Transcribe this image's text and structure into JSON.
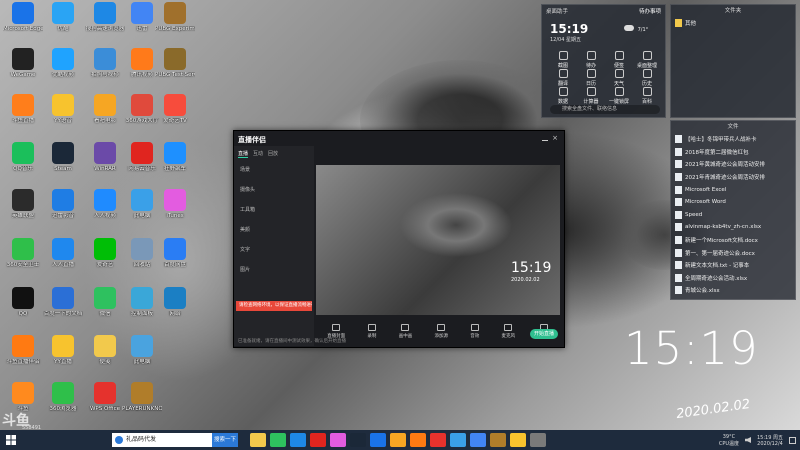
{
  "desktop_icons": [
    {
      "label": "Microsoft Edge",
      "icon": "edge-icon",
      "color": "#1a73e8"
    },
    {
      "label": "优酷",
      "icon": "youku-icon",
      "color": "#2aa4f4"
    },
    {
      "label": "搜狗高速浏览器",
      "icon": "sogou-browser-icon",
      "color": "#1e88e5"
    },
    {
      "label": "迅雷",
      "icon": "thunder-icon",
      "color": "#4285f4"
    },
    {
      "label": "PUBG Experimental",
      "icon": "pubg-icon",
      "color": "#a0702c"
    },
    {
      "label": "WeGame",
      "icon": "wegame-icon",
      "color": "#222222"
    },
    {
      "label": "优酷视频",
      "icon": "youku-video-icon",
      "color": "#1fa3ff"
    },
    {
      "label": "拍照与视频",
      "icon": "photo-icon",
      "color": "#3b8dd8"
    },
    {
      "label": "腾讯视频",
      "icon": "tencent-video-icon",
      "color": "#ff7a1a"
    },
    {
      "label": "PUBG Test Server",
      "icon": "pubg-test-icon",
      "color": "#8a6a2a"
    },
    {
      "label": "斗鱼直播",
      "icon": "douyu-icon",
      "color": "#ff7e1b"
    },
    {
      "label": "YY语音",
      "icon": "yy-icon",
      "color": "#f7c32e"
    },
    {
      "label": "看吧电影",
      "icon": "movie-icon",
      "color": "#f6a623"
    },
    {
      "label": "360游戏大厅",
      "icon": "game-hall-icon",
      "color": "#e04a3c"
    },
    {
      "label": "爱奇艺TV",
      "icon": "iqiyi-tv-icon",
      "color": "#f74c3c"
    },
    {
      "label": "QQ音乐",
      "icon": "qq-music-icon",
      "color": "#1bbf5b"
    },
    {
      "label": "Steam",
      "icon": "steam-icon",
      "color": "#1b2838"
    },
    {
      "label": "WinRAR",
      "icon": "winrar-icon",
      "color": "#6b4aa8"
    },
    {
      "label": "网易云音乐",
      "icon": "netease-music-icon",
      "color": "#e0251f"
    },
    {
      "label": "狂野飙车",
      "icon": "race-icon",
      "color": "#1e90ff"
    },
    {
      "label": "英雄联盟",
      "icon": "lol-icon",
      "color": "#2b2b2b"
    },
    {
      "label": "迅雷影音",
      "icon": "thunder-player-icon",
      "color": "#1f7de4"
    },
    {
      "label": "人人视频",
      "icon": "renren-video-icon",
      "color": "#1f8bff"
    },
    {
      "label": "此电脑",
      "icon": "computer-icon",
      "color": "#3aa0e8"
    },
    {
      "label": "iTunes",
      "icon": "itunes-icon",
      "color": "#e35ce0"
    },
    {
      "label": "360安全卫士",
      "icon": "security-guard-icon",
      "color": "#2fbf4a"
    },
    {
      "label": "人人直播",
      "icon": "renren-live-icon",
      "color": "#1f88ee"
    },
    {
      "label": "爱奇艺",
      "icon": "iqiyi-icon",
      "color": "#00be06"
    },
    {
      "label": "回收站",
      "icon": "recycle-bin-icon",
      "color": "#7a98b8"
    },
    {
      "label": "百度网盘",
      "icon": "baidu-netdisk-icon",
      "color": "#2a7df4"
    },
    {
      "label": "QQ",
      "icon": "qq-icon",
      "color": "#111111"
    },
    {
      "label": "百度一下的文档",
      "icon": "word-doc-icon",
      "color": "#2b6fd6"
    },
    {
      "label": "微信",
      "icon": "wechat-icon",
      "color": "#2ec15f"
    },
    {
      "label": "控制面板",
      "icon": "control-panel-icon",
      "color": "#3aa7d8"
    },
    {
      "label": "网络",
      "icon": "network-icon",
      "color": "#1b7fc4"
    },
    {
      "label": "斗鱼直播伴侣",
      "icon": "douyu-companion-icon",
      "color": "#ff7a12"
    },
    {
      "label": "YY直播",
      "icon": "yy-live-icon",
      "color": "#f7c32e"
    },
    {
      "label": "便笺",
      "icon": "sticky-notes-icon",
      "color": "#f2c94c"
    },
    {
      "label": "此电脑",
      "icon": "laptop-icon",
      "color": "#4aa3df"
    },
    {
      "label": "斗鱼",
      "icon": "douyu-small-icon",
      "color": "#ff8a1e"
    },
    {
      "label": "360浏览器",
      "icon": "browser-360-icon",
      "color": "#2fbf4a"
    },
    {
      "label": "WPS Office",
      "icon": "wps-icon",
      "color": "#e5322d"
    },
    {
      "label": "PLAYERUNKNOWN'S BATTLEGROUNDS",
      "icon": "pubg-main-icon",
      "color": "#b07d2a"
    }
  ],
  "tool_panel": {
    "title": "桌面助手",
    "tab": "待办事项",
    "time": "15:19",
    "date": "12/04 星期五",
    "weather": "7/1°",
    "tools": [
      {
        "label": "截图",
        "icon": "screenshot-icon"
      },
      {
        "label": "待办",
        "icon": "todo-icon"
      },
      {
        "label": "便签",
        "icon": "note-icon"
      },
      {
        "label": "桌面整理",
        "icon": "organize-icon"
      },
      {
        "label": "翻译",
        "icon": "translate-icon"
      },
      {
        "label": "日历",
        "icon": "calendar-icon"
      },
      {
        "label": "天气",
        "icon": "weather-icon"
      },
      {
        "label": "历史",
        "icon": "history-icon"
      },
      {
        "label": "数据",
        "icon": "data-icon"
      },
      {
        "label": "计算器",
        "icon": "calculator-icon"
      },
      {
        "label": "一键锁屏",
        "icon": "lock-icon"
      },
      {
        "label": "百科",
        "icon": "wiki-icon"
      }
    ],
    "search_placeholder": "搜索全盘文件、联络信息"
  },
  "file_panel_top": {
    "title": "文件夹",
    "item": "其他"
  },
  "file_panel": {
    "title": "文件",
    "items": [
      "【哈士】冬锦甲带兵人战补卡",
      "2018年度第二届微信红包",
      "2021年黄城奇迹公会周活动安排",
      "2021年青城奇迹公会周活动安排",
      "Microsoft Excel",
      "Microsoft Word",
      "Speed",
      "alvinmap-ksb4tv_zh-cn.xlsx",
      "新建一个Microsoft文档.docx",
      "第一、第一届奇迹公会.docx",
      "新建文本文档.txt - 记事本",
      "全周期奇迹公会活动.xlsx",
      "青城公会.xlsx"
    ]
  },
  "app": {
    "title": "直播伴侣",
    "tabs": [
      "直播",
      "互动",
      "回放"
    ],
    "sidebar_items": [
      "场景",
      "摄像头",
      "工具箱",
      "美颜",
      "文字",
      "图片"
    ],
    "live_notice": "请检查网络环境，以保证直播流畅进行，建议使用有线网络",
    "buttons": [
      {
        "label": "直播封面",
        "icon": "cover-icon"
      },
      {
        "label": "录制",
        "icon": "record-icon"
      },
      {
        "label": "画中画",
        "icon": "pip-icon"
      },
      {
        "label": "添加源",
        "icon": "add-source-icon"
      },
      {
        "label": "音效",
        "icon": "sound-icon"
      },
      {
        "label": "麦克风",
        "icon": "mic-icon"
      },
      {
        "label": "摄像头",
        "icon": "camera-icon"
      }
    ],
    "start_button": "开始直播",
    "status": "已准备就绪，请在直播间中测试效果，确认后开始直播",
    "preview_time": "15:19",
    "preview_date": "2020.02.02"
  },
  "big_clock": {
    "time": "15:19",
    "date": "2020.02.02"
  },
  "watermark": {
    "text": "斗鱼",
    "sub": "558491"
  },
  "taskbar": {
    "search_text": "礼品码代发",
    "search_button": "搜索一下",
    "temperature": "39°C",
    "cpu": "CPU温度",
    "time": "15:19 周五",
    "date": "2020/12/4",
    "apps": [
      {
        "icon": "file-explorer-icon",
        "color": "#f2c94c"
      },
      {
        "icon": "wechat-taskbar-icon",
        "color": "#2ec15f"
      },
      {
        "icon": "qq-taskbar-icon",
        "color": "#1e88e5"
      },
      {
        "icon": "netease-taskbar-icon",
        "color": "#e0251f"
      },
      {
        "icon": "music-taskbar-icon",
        "color": "#e35ce0"
      },
      {
        "icon": "steam-taskbar-icon",
        "color": "#1b2838"
      },
      {
        "icon": "edge-taskbar-icon",
        "color": "#1a73e8"
      },
      {
        "icon": "game-taskbar-icon",
        "color": "#f6a623"
      },
      {
        "icon": "douyu-taskbar-icon",
        "color": "#ff7a12"
      },
      {
        "icon": "wps-taskbar-icon",
        "color": "#e5322d"
      },
      {
        "icon": "sogou-taskbar-icon",
        "color": "#3aa0e8"
      },
      {
        "icon": "thunder-taskbar-icon",
        "color": "#4285f4"
      },
      {
        "icon": "pubg-taskbar-icon",
        "color": "#b07d2a"
      },
      {
        "icon": "yy-taskbar-icon",
        "color": "#f7c32e"
      },
      {
        "icon": "settings-taskbar-icon",
        "color": "#7a7a7a"
      }
    ]
  }
}
